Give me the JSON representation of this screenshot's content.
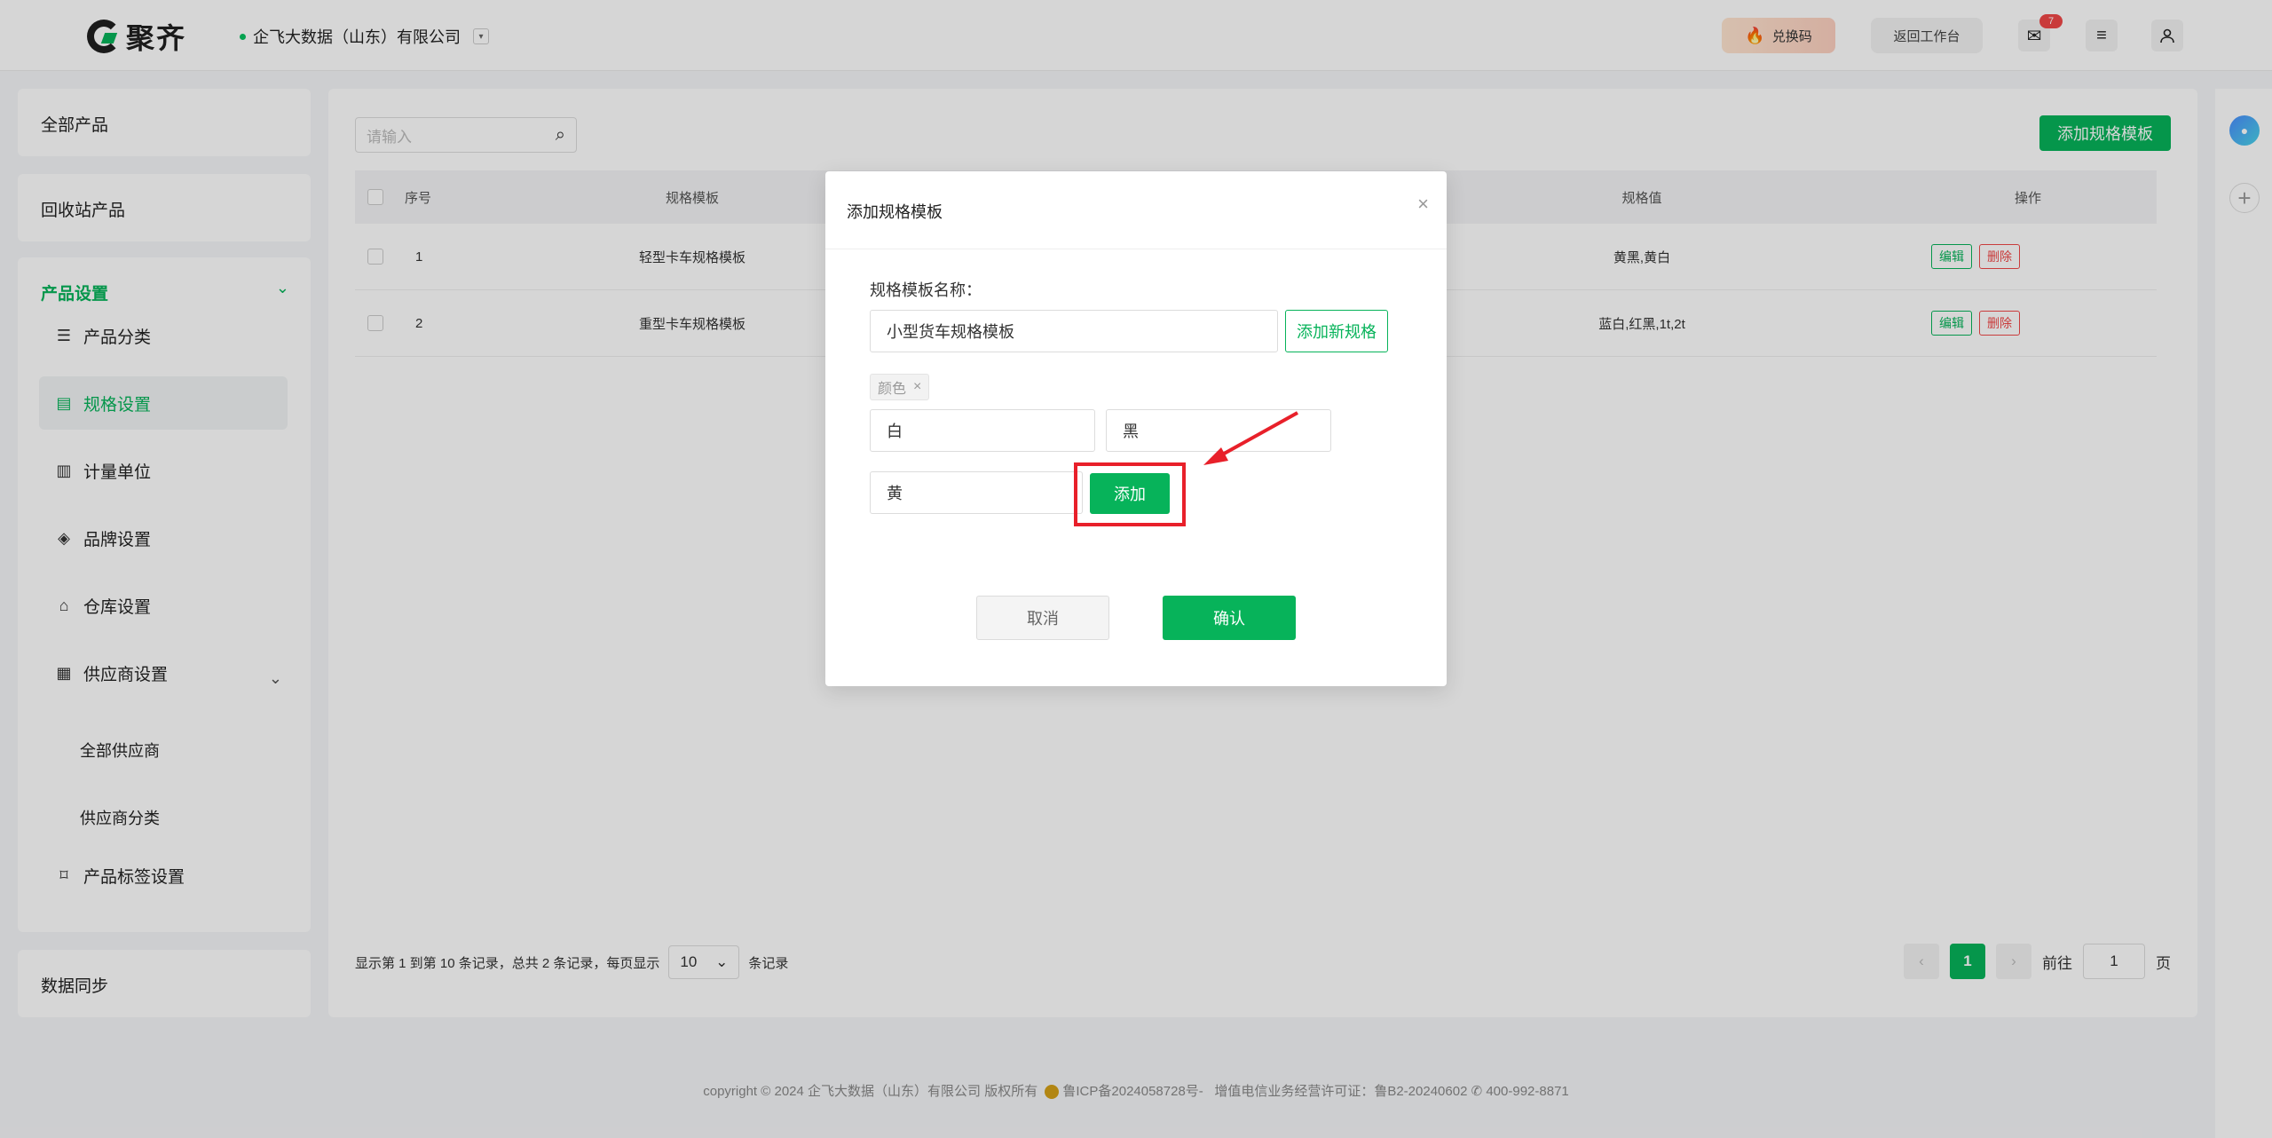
{
  "header": {
    "logo_text": "聚齐",
    "company": "企飞大数据（山东）有限公司",
    "redeem_label": "兑换码",
    "back_workspace_label": "返回工作台",
    "mail_badge": "7"
  },
  "sidebar": {
    "all_products": "全部产品",
    "recycle_products": "回收站产品",
    "product_settings": "产品设置",
    "items": [
      {
        "label": "产品分类",
        "icon": "list-icon"
      },
      {
        "label": "规格设置",
        "icon": "spec-icon"
      },
      {
        "label": "计量单位",
        "icon": "unit-icon"
      },
      {
        "label": "品牌设置",
        "icon": "tag-icon"
      },
      {
        "label": "仓库设置",
        "icon": "warehouse-icon"
      },
      {
        "label": "供应商设置",
        "icon": "supplier-icon"
      },
      {
        "label": "产品标签设置",
        "icon": "bookmark-icon"
      }
    ],
    "supplier_sub": [
      "全部供应商",
      "供应商分类"
    ],
    "data_sync": "数据同步"
  },
  "main": {
    "search_placeholder": "请输入",
    "add_template_button": "添加规格模板",
    "columns": [
      "序号",
      "规格模板",
      "规格值",
      "操作"
    ],
    "rows": [
      {
        "no": "1",
        "template": "轻型卡车规格模板",
        "values": "黄黑,黄白"
      },
      {
        "no": "2",
        "template": "重型卡车规格模板",
        "values": "蓝白,红黑,1t,2t"
      }
    ],
    "edit_label": "编辑",
    "delete_label": "删除",
    "footer_info_prefix": "显示第 1 到第 10 条记录，总共 2 条记录，每页显示",
    "page_size": "10",
    "footer_info_suffix": "条记录",
    "current_page": "1",
    "goto_label": "前往",
    "goto_value": "1",
    "page_unit": "页"
  },
  "copyright": {
    "text": "copyright © 2024 企飞大数据（山东）有限公司 版权所有",
    "icp": "鲁ICP备2024058728号-",
    "license": "增值电信业务经营许可证：鲁B2-20240602",
    "phone": "400-992-8871"
  },
  "modal": {
    "title": "添加规格模板",
    "name_label": "规格模板名称：",
    "name_value": "小型货车规格模板",
    "add_spec_button": "添加新规格",
    "spec_tag": "颜色",
    "spec_values": [
      "白",
      "黑",
      "黄"
    ],
    "add_button": "添加",
    "cancel_button": "取消",
    "confirm_button": "确认"
  },
  "colors": {
    "accent": "#07b35a",
    "danger": "#f04848",
    "annotation": "#e8202a"
  }
}
